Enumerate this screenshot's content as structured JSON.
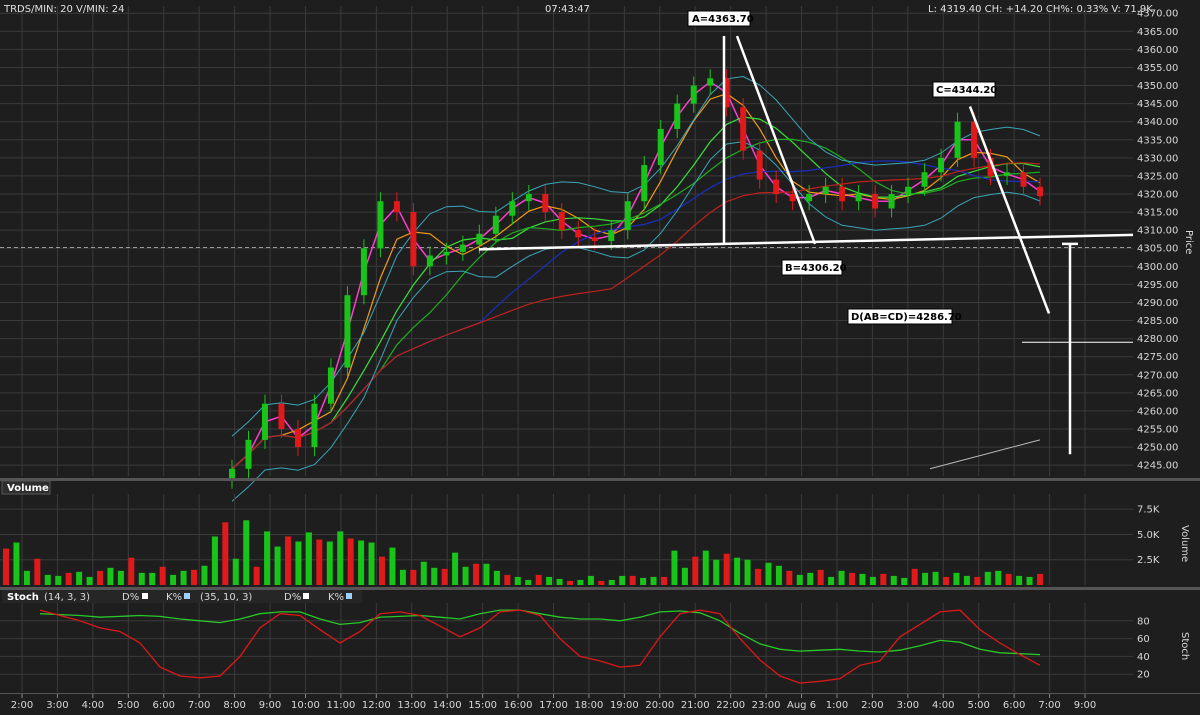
{
  "header": {
    "symbol": "TRDS/MIN: 20 V/MIN: 24",
    "time": "07:43:47",
    "quote": "L: 4319.40 CH: +14.20 CH%: 0.33% V: 71.9K"
  },
  "chart_data": [
    {
      "type": "candlestick",
      "title": "",
      "ylabel": "Price",
      "ylim": [
        4242,
        4372
      ],
      "yticks": [
        "4370.00",
        "4365.00",
        "4360.00",
        "4355.00",
        "4350.00",
        "4345.00",
        "4340.00",
        "4335.00",
        "4330.00",
        "4325.00",
        "4320.00",
        "4315.00",
        "4310.00",
        "4305.00",
        "4300.00",
        "4295.00",
        "4290.00",
        "4285.00",
        "4280.00",
        "4275.00",
        "4270.00",
        "4265.00",
        "4260.00",
        "4255.00",
        "4250.00",
        "4245.00"
      ],
      "xticks": [
        "2:00",
        "3:00",
        "4:00",
        "5:00",
        "6:00",
        "7:00",
        "8:00",
        "9:00",
        "10:00",
        "11:00",
        "12:00",
        "13:00",
        "14:00",
        "15:00",
        "16:00",
        "17:00",
        "18:00",
        "19:00",
        "20:00",
        "21:00",
        "22:00",
        "23:00",
        "Aug 6",
        "1:00",
        "2:00",
        "3:00",
        "4:00",
        "5:00",
        "6:00",
        "7:00",
        "9:00"
      ],
      "reference_price": 4305.2,
      "close_series": [
        4244,
        4252,
        4262,
        4255,
        4250,
        4262,
        4272,
        4292,
        4305,
        4318,
        4315,
        4300,
        4303,
        4304,
        4306,
        4309,
        4314,
        4318,
        4320,
        4315,
        4310,
        4308,
        4307,
        4310,
        4318,
        4328,
        4338,
        4345,
        4350,
        4352,
        4344,
        4332,
        4324,
        4320,
        4318,
        4320,
        4322,
        4318,
        4320,
        4316,
        4320,
        4322,
        4326,
        4330,
        4340,
        4330,
        4325,
        4326,
        4322,
        4319.4
      ],
      "annotations": [
        {
          "label": "A=4363.70",
          "price": 4363.7
        },
        {
          "label": "B=4306.20",
          "price": 4306.2
        },
        {
          "label": "C=4344.20",
          "price": 4344.2
        },
        {
          "label": "D(AB=CD)=4286.70",
          "price": 4286.7
        }
      ],
      "colors": {
        "up": "#19c419",
        "down": "#e01a1a",
        "background": "#1e1e1e",
        "grid": "#3a3a3a"
      }
    },
    {
      "type": "bar",
      "title": "Volume",
      "ylabel": "Volume",
      "yticks": [
        "7.5K",
        "5.0K",
        "2.5K"
      ],
      "ylim": [
        0,
        9000
      ],
      "values": [
        3600,
        4200,
        1400,
        2600,
        1000,
        900,
        1200,
        1300,
        800,
        1400,
        1700,
        1400,
        2700,
        1200,
        1200,
        1800,
        1000,
        1400,
        1500,
        1900,
        4800,
        6200,
        2600,
        6400,
        1800,
        5300,
        3800,
        4800,
        4300,
        5200,
        4500,
        4300,
        5300,
        4600,
        4400,
        4200,
        2800,
        3700,
        1500,
        1500,
        2300,
        1700,
        1600,
        3200,
        1800,
        2100,
        2100,
        1400,
        1000,
        800,
        500,
        1000,
        800,
        600,
        400,
        500,
        900,
        400,
        500,
        900,
        900,
        700,
        800,
        800,
        3400,
        1700,
        2800,
        3400,
        2500,
        3100,
        2700,
        2500,
        1600,
        2200,
        1900,
        1400,
        1000,
        1200,
        1500,
        800,
        1400,
        1200,
        1100,
        800,
        1100,
        900,
        700,
        1600,
        1200,
        1300,
        800,
        1200,
        900,
        800,
        1300,
        1400,
        1100,
        900,
        800,
        1100
      ]
    },
    {
      "type": "line",
      "title": "Stoch",
      "params": [
        "(14, 3, 3)",
        "D%",
        "K%",
        "(35, 10, 3)",
        "D%",
        "K%"
      ],
      "ylim": [
        0,
        100
      ],
      "yticks": [
        "80",
        "60",
        "40",
        "20"
      ],
      "ylabel": "Stoch",
      "series": [
        {
          "name": "D%",
          "color": "#28c828",
          "values": [
            88,
            87,
            86,
            84,
            85,
            86,
            85,
            82,
            80,
            78,
            82,
            88,
            90,
            90,
            82,
            76,
            78,
            84,
            85,
            86,
            84,
            82,
            88,
            92,
            92,
            88,
            84,
            82,
            82,
            80,
            84,
            90,
            91,
            89,
            80,
            66,
            54,
            48,
            46,
            47,
            48,
            46,
            45,
            47,
            52,
            58,
            56,
            48,
            44,
            43,
            42
          ]
        },
        {
          "name": "K%",
          "color": "#dd1818",
          "values": [
            92,
            86,
            80,
            72,
            68,
            55,
            28,
            18,
            16,
            18,
            40,
            72,
            88,
            86,
            70,
            55,
            68,
            88,
            90,
            86,
            74,
            62,
            72,
            90,
            92,
            86,
            60,
            40,
            35,
            28,
            30,
            62,
            88,
            92,
            88,
            60,
            36,
            18,
            10,
            12,
            15,
            30,
            35,
            62,
            76,
            90,
            92,
            70,
            55,
            42,
            30
          ]
        }
      ]
    }
  ]
}
